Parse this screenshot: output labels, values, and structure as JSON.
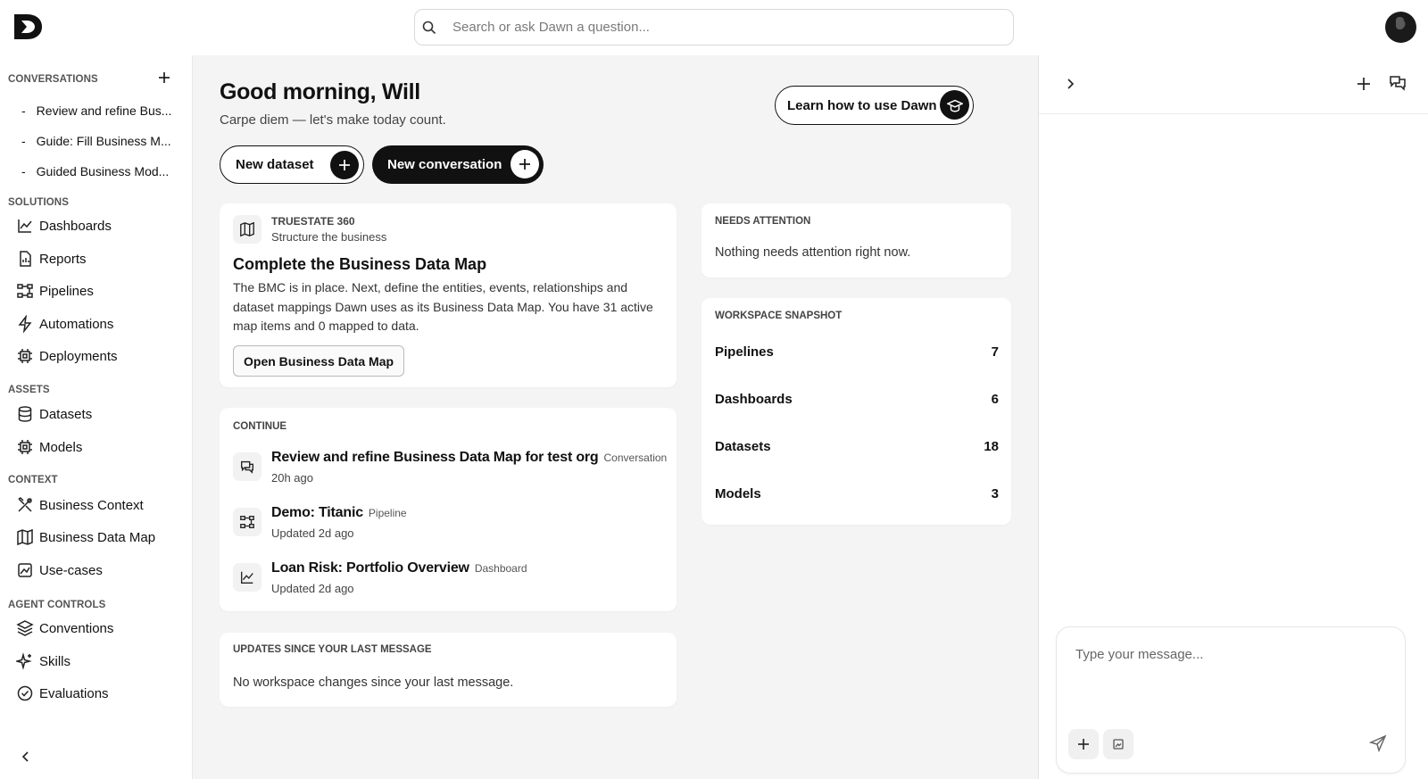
{
  "search": {
    "placeholder": "Search or ask Dawn a question..."
  },
  "sidebar": {
    "conversations_title": "CONVERSATIONS",
    "conversations": [
      {
        "label": "Review and refine Bus..."
      },
      {
        "label": "Guide: Fill Business M..."
      },
      {
        "label": "Guided Business Mod..."
      }
    ],
    "solutions_title": "SOLUTIONS",
    "solutions": [
      {
        "label": "Dashboards",
        "icon": "chart-line-icon"
      },
      {
        "label": "Reports",
        "icon": "report-icon"
      },
      {
        "label": "Pipelines",
        "icon": "pipeline-icon"
      },
      {
        "label": "Automations",
        "icon": "bolt-icon"
      },
      {
        "label": "Deployments",
        "icon": "deploy-icon"
      }
    ],
    "assets_title": "ASSETS",
    "assets": [
      {
        "label": "Datasets",
        "icon": "database-icon"
      },
      {
        "label": "Models",
        "icon": "model-icon"
      }
    ],
    "context_title": "CONTEXT",
    "context": [
      {
        "label": "Business Context",
        "icon": "tools-icon"
      },
      {
        "label": "Business Data Map",
        "icon": "map-icon"
      },
      {
        "label": "Use-cases",
        "icon": "image-chart-icon"
      }
    ],
    "agent_title": "AGENT CONTROLS",
    "agent": [
      {
        "label": "Conventions",
        "icon": "layers-icon"
      },
      {
        "label": "Skills",
        "icon": "sparkle-icon"
      },
      {
        "label": "Evaluations",
        "icon": "check-circle-icon"
      }
    ]
  },
  "main": {
    "greeting": "Good morning, Will",
    "subtitle": "Carpe diem — let's make today count.",
    "learn_label": "Learn how to use Dawn",
    "new_dataset_label": "New dataset",
    "new_conversation_label": "New conversation",
    "truestate": {
      "kicker": "TRUESTATE 360",
      "kicker_sub": "Structure the business",
      "title": "Complete the Business Data Map",
      "description": "The BMC is in place. Next, define the entities, events, relationships and dataset mappings Dawn uses as its Business Data Map. You have 31 active map items and 0 mapped to data.",
      "button": "Open Business Data Map"
    },
    "continue": {
      "title": "CONTINUE",
      "items": [
        {
          "title": "Review and refine Business Data Map for test org",
          "tag": "Conversation",
          "sub": "20h ago",
          "icon": "chat-icon"
        },
        {
          "title": "Demo: Titanic",
          "tag": "Pipeline",
          "sub": "Updated 2d ago",
          "icon": "pipeline-icon"
        },
        {
          "title": "Loan Risk: Portfolio Overview",
          "tag": "Dashboard",
          "sub": "Updated 2d ago",
          "icon": "chart-line-icon"
        }
      ]
    },
    "updates": {
      "title": "UPDATES SINCE YOUR LAST MESSAGE",
      "body": "No workspace changes since your last message."
    },
    "attention": {
      "title": "NEEDS ATTENTION",
      "body": "Nothing needs attention right now."
    },
    "snapshot": {
      "title": "WORKSPACE SNAPSHOT",
      "rows": [
        {
          "label": "Pipelines",
          "value": "7"
        },
        {
          "label": "Dashboards",
          "value": "6"
        },
        {
          "label": "Datasets",
          "value": "18"
        },
        {
          "label": "Models",
          "value": "3"
        }
      ]
    }
  },
  "chat": {
    "placeholder": "Type your message..."
  }
}
